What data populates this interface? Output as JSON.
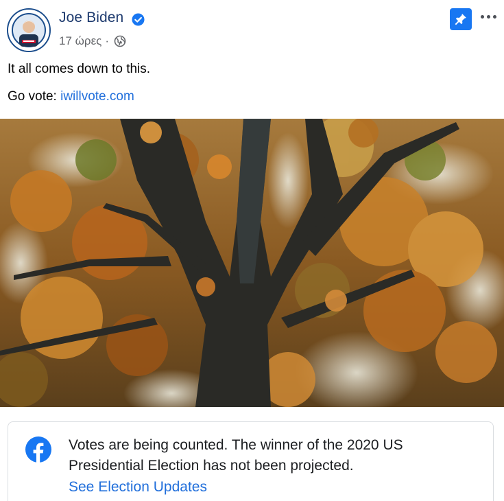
{
  "post": {
    "author": "Joe Biden",
    "verified": true,
    "time": "17 ώρες",
    "separator": "·",
    "privacy_icon": "globe-icon",
    "text_line1": "It all comes down to this.",
    "text_line2_prefix": "Go vote: ",
    "text_link": "iwillvote.com"
  },
  "header_actions": {
    "pin_icon": "pin-icon",
    "more_icon": "more-options-icon"
  },
  "video": {
    "description_icon": "muted-speaker-icon",
    "muted": true
  },
  "info_card": {
    "icon": "facebook-logo-icon",
    "message": "Votes are being counted. The winner of the 2020 US Presidential Election has not been projected.",
    "link_label": "See Election Updates"
  },
  "colors": {
    "link": "#216fdb",
    "brand": "#1877f2",
    "author": "#1d3a6e",
    "meta": "#65676b"
  }
}
